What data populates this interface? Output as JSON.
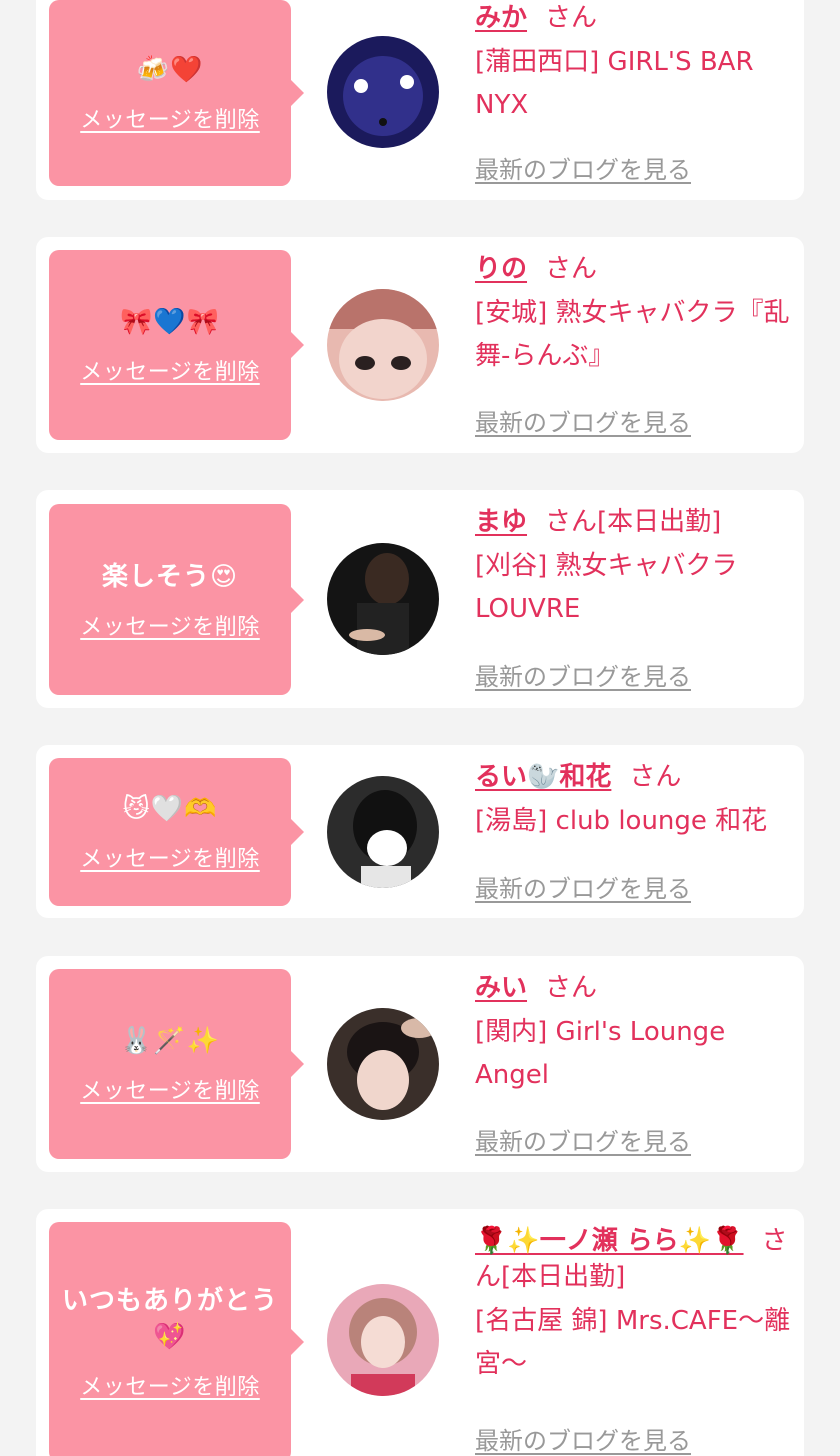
{
  "favorites": [
    {
      "message": "🍻❤️",
      "delete_label": "メッセージを削除",
      "name": "みか",
      "honorific": "さん",
      "status": "",
      "shop": "[蒲田西口] GIRL'S BAR NYX",
      "blog_label": "最新のブログを見る",
      "avatar_color": "#1b1a5c"
    },
    {
      "message": "🎀💙🎀",
      "delete_label": "メッセージを削除",
      "name": "りの",
      "honorific": "さん",
      "status": "",
      "shop": "[安城] 熟女キャバクラ『乱舞-らんぶ』",
      "blog_label": "最新のブログを見る",
      "avatar_color": "#e8b9b0"
    },
    {
      "message": "楽しそう😍",
      "delete_label": "メッセージを削除",
      "name": "まゆ",
      "honorific": "さん",
      "status": "[本日出勤]",
      "shop": "[刈谷] 熟女キャバクラLOUVRE",
      "blog_label": "最新のブログを見る",
      "avatar_color": "#141414"
    },
    {
      "message": "😼🤍🫶",
      "delete_label": "メッセージを削除",
      "name": "るい🦭和花",
      "honorific": "さん",
      "status": "",
      "shop": "[湯島] club lounge 和花",
      "blog_label": "最新のブログを見る",
      "avatar_color": "#2c2c2c"
    },
    {
      "message": "🐰🪄✨",
      "delete_label": "メッセージを削除",
      "name": "みい",
      "honorific": "さん",
      "status": "",
      "shop": "[関内] Girl's Lounge Angel",
      "blog_label": "最新のブログを見る",
      "avatar_color": "#3a2f2a"
    },
    {
      "message": "いつもありがとう💖",
      "delete_label": "メッセージを削除",
      "name": "🌹✨一ノ瀬 らら✨🌹",
      "honorific": "さん",
      "status": "[本日出勤]",
      "shop": "[名古屋 錦] Mrs.CAFE〜離宮〜",
      "blog_label": "最新のブログを見る",
      "avatar_color": "#e9a8b8"
    }
  ]
}
